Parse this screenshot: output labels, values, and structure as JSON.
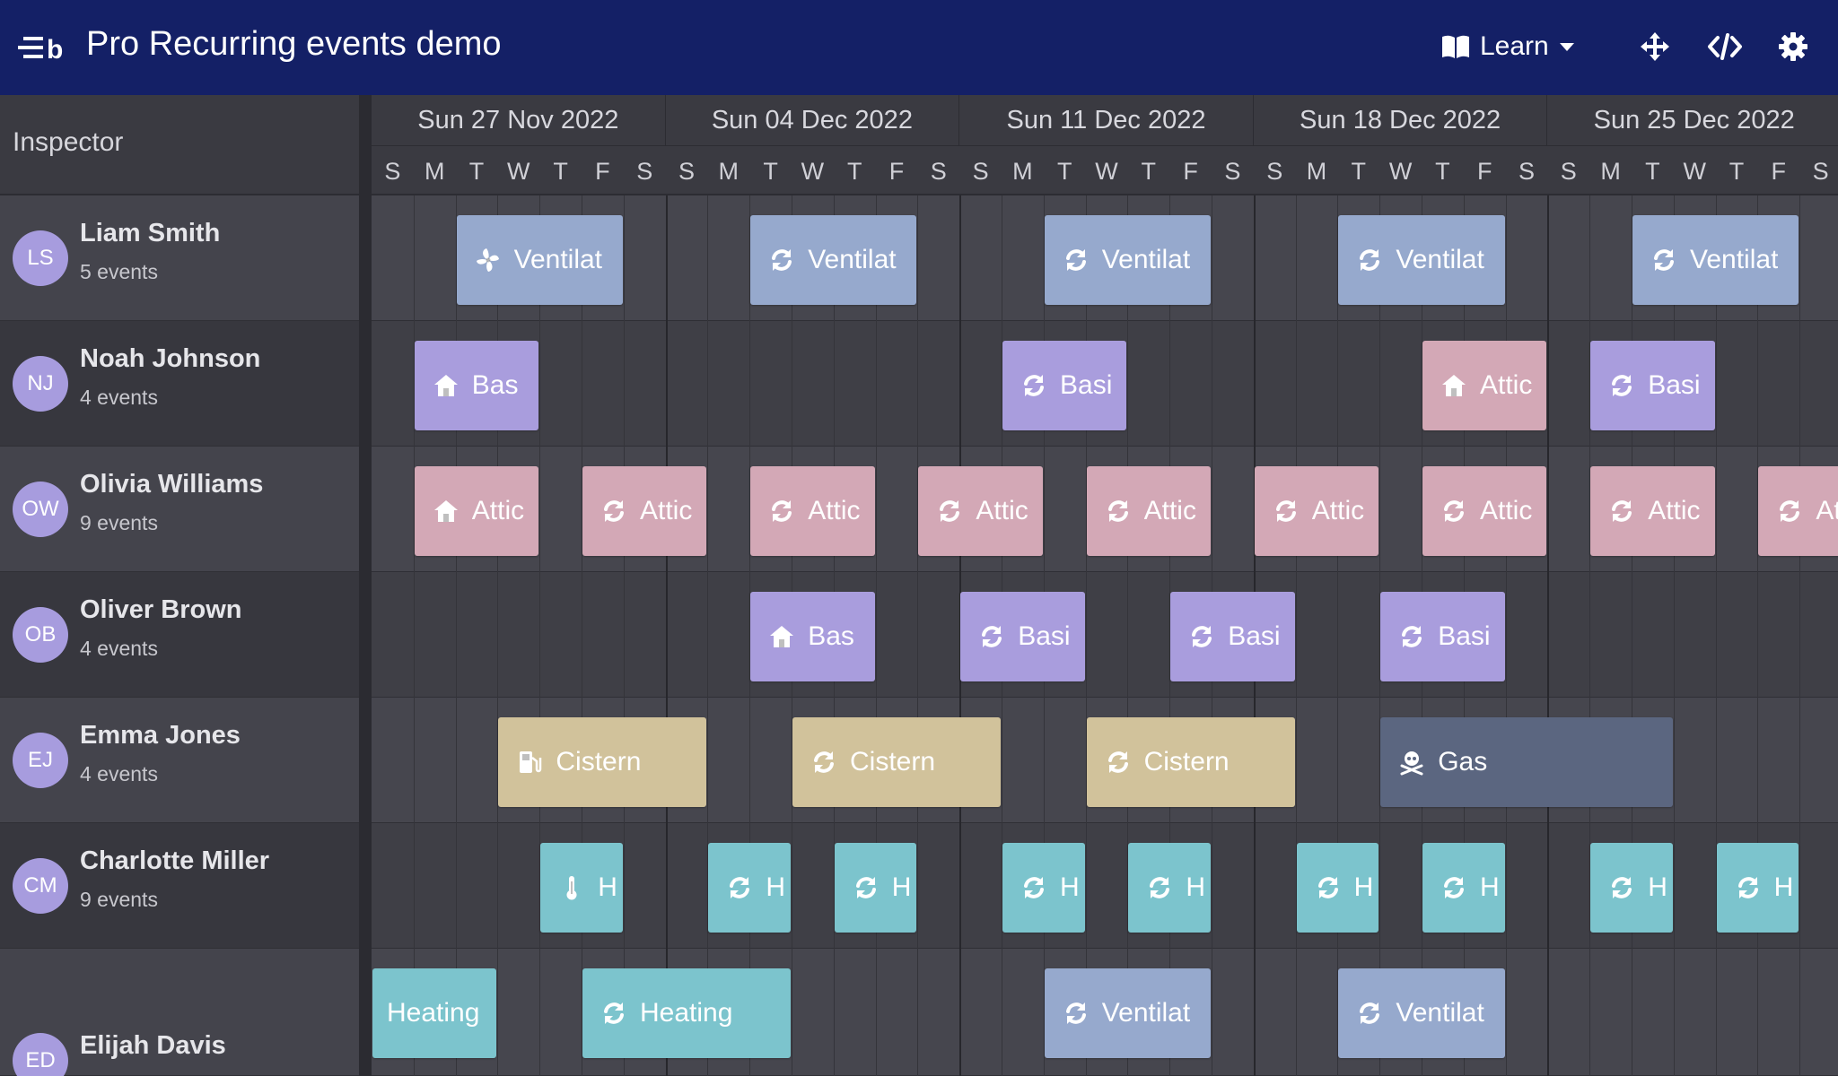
{
  "app": {
    "title": "Pro Recurring events demo",
    "logo": "bryntum-logo"
  },
  "toolbar": {
    "learn_label": "Learn",
    "icons": [
      "book-icon",
      "caret-down-icon",
      "move-icon",
      "code-icon",
      "gear-icon"
    ]
  },
  "left_header": {
    "label": "Inspector"
  },
  "weeks": [
    "Sun 27 Nov 2022",
    "Sun 04 Dec 2022",
    "Sun 11 Dec 2022",
    "Sun 18 Dec 2022",
    "Sun 25 Dec 2022"
  ],
  "days": [
    "S",
    "M",
    "T",
    "W",
    "T",
    "F",
    "S"
  ],
  "colors": {
    "header": "#142066",
    "ventilation": "#96a9cd",
    "basement": "#a99ddd",
    "attic": "#d3a8b6",
    "cistern": "#d1c29b",
    "gas": "#5b6680",
    "heating": "#7cc4cd"
  },
  "resources": [
    {
      "initials": "LS",
      "name": "Liam Smith",
      "count": "5 events",
      "events": [
        {
          "day": 2,
          "len": 4,
          "label": "Ventilat",
          "type": "ventilation",
          "icon": "fan-icon"
        },
        {
          "day": 9,
          "len": 4,
          "label": "Ventilat",
          "type": "ventilation",
          "icon": "recurring-icon"
        },
        {
          "day": 16,
          "len": 4,
          "label": "Ventilat",
          "type": "ventilation",
          "icon": "recurring-icon"
        },
        {
          "day": 23,
          "len": 4,
          "label": "Ventilat",
          "type": "ventilation",
          "icon": "recurring-icon"
        },
        {
          "day": 30,
          "len": 4,
          "label": "Ventilat",
          "type": "ventilation",
          "icon": "recurring-icon"
        }
      ]
    },
    {
      "initials": "NJ",
      "name": "Noah Johnson",
      "count": "4 events",
      "events": [
        {
          "day": 1,
          "len": 3,
          "label": "Bas",
          "type": "basement",
          "icon": "house-icon"
        },
        {
          "day": 15,
          "len": 3,
          "label": "Basi",
          "type": "basement",
          "icon": "recurring-icon"
        },
        {
          "day": 25,
          "len": 3,
          "label": "Attic",
          "type": "attic",
          "icon": "house-icon"
        },
        {
          "day": 29,
          "len": 3,
          "label": "Basi",
          "type": "basement",
          "icon": "recurring-icon"
        }
      ]
    },
    {
      "initials": "OW",
      "name": "Olivia Williams",
      "count": "9 events",
      "events": [
        {
          "day": 1,
          "len": 3,
          "label": "Attic",
          "type": "attic",
          "icon": "house-icon"
        },
        {
          "day": 5,
          "len": 3,
          "label": "Attic",
          "type": "attic",
          "icon": "recurring-icon"
        },
        {
          "day": 9,
          "len": 3,
          "label": "Attic",
          "type": "attic",
          "icon": "recurring-icon"
        },
        {
          "day": 13,
          "len": 3,
          "label": "Attic",
          "type": "attic",
          "icon": "recurring-icon"
        },
        {
          "day": 17,
          "len": 3,
          "label": "Attic",
          "type": "attic",
          "icon": "recurring-icon"
        },
        {
          "day": 21,
          "len": 3,
          "label": "Attic",
          "type": "attic",
          "icon": "recurring-icon"
        },
        {
          "day": 25,
          "len": 3,
          "label": "Attic",
          "type": "attic",
          "icon": "recurring-icon"
        },
        {
          "day": 29,
          "len": 3,
          "label": "Attic",
          "type": "attic",
          "icon": "recurring-icon"
        },
        {
          "day": 33,
          "len": 3,
          "label": "Attic",
          "type": "attic",
          "icon": "recurring-icon"
        }
      ]
    },
    {
      "initials": "OB",
      "name": "Oliver Brown",
      "count": "4 events",
      "events": [
        {
          "day": 9,
          "len": 3,
          "label": "Bas",
          "type": "basement",
          "icon": "house-icon"
        },
        {
          "day": 14,
          "len": 3,
          "label": "Basi",
          "type": "basement",
          "icon": "recurring-icon"
        },
        {
          "day": 19,
          "len": 3,
          "label": "Basi",
          "type": "basement",
          "icon": "recurring-icon"
        },
        {
          "day": 24,
          "len": 3,
          "label": "Basi",
          "type": "basement",
          "icon": "recurring-icon"
        }
      ]
    },
    {
      "initials": "EJ",
      "name": "Emma Jones",
      "count": "4 events",
      "events": [
        {
          "day": 3,
          "len": 5,
          "label": "Cistern",
          "type": "cistern",
          "icon": "gas-pump-icon"
        },
        {
          "day": 10,
          "len": 5,
          "label": "Cistern",
          "type": "cistern",
          "icon": "recurring-icon"
        },
        {
          "day": 17,
          "len": 5,
          "label": "Cistern",
          "type": "cistern",
          "icon": "recurring-icon"
        },
        {
          "day": 24,
          "len": 7,
          "label": "Gas",
          "type": "gas",
          "icon": "skull-icon"
        }
      ]
    },
    {
      "initials": "CM",
      "name": "Charlotte Miller",
      "count": "9 events",
      "events": [
        {
          "day": 4,
          "len": 2,
          "label": "H",
          "type": "heating",
          "icon": "thermometer-icon"
        },
        {
          "day": 8,
          "len": 2,
          "label": "H",
          "type": "heating",
          "icon": "recurring-icon"
        },
        {
          "day": 11,
          "len": 2,
          "label": "H",
          "type": "heating",
          "icon": "recurring-icon"
        },
        {
          "day": 15,
          "len": 2,
          "label": "H",
          "type": "heating",
          "icon": "recurring-icon"
        },
        {
          "day": 18,
          "len": 2,
          "label": "H",
          "type": "heating",
          "icon": "recurring-icon"
        },
        {
          "day": 22,
          "len": 2,
          "label": "H",
          "type": "heating",
          "icon": "recurring-icon"
        },
        {
          "day": 25,
          "len": 2,
          "label": "H",
          "type": "heating",
          "icon": "recurring-icon"
        },
        {
          "day": 29,
          "len": 2,
          "label": "H",
          "type": "heating",
          "icon": "recurring-icon"
        },
        {
          "day": 32,
          "len": 2,
          "label": "H",
          "type": "heating",
          "icon": "recurring-icon"
        }
      ]
    },
    {
      "initials": "ED",
      "name": "Elijah Davis",
      "count": "",
      "events": [
        {
          "day": 0,
          "len": 3,
          "label": "Heating",
          "type": "heating",
          "icon": "none"
        },
        {
          "day": 5,
          "len": 5,
          "label": "Heating",
          "type": "heating",
          "icon": "recurring-icon"
        },
        {
          "day": 16,
          "len": 4,
          "label": "Ventilat",
          "type": "ventilation",
          "icon": "recurring-icon"
        },
        {
          "day": 23,
          "len": 4,
          "label": "Ventilat",
          "type": "ventilation",
          "icon": "recurring-icon"
        }
      ]
    }
  ]
}
